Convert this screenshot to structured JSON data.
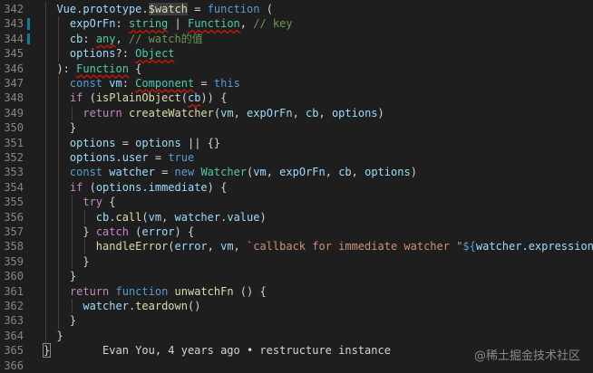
{
  "editor": {
    "lines": [
      {
        "num": "342",
        "changed": false,
        "tokens": [
          [
            "plain",
            "  "
          ],
          [
            "var",
            "Vue"
          ],
          [
            "punc",
            "."
          ],
          [
            "var",
            "prototype"
          ],
          [
            "punc",
            "."
          ],
          [
            "fn",
            "$watch"
          ],
          [
            "punc",
            " = "
          ],
          [
            "kw",
            "function"
          ],
          [
            "punc",
            " ("
          ]
        ]
      },
      {
        "num": "343",
        "changed": true,
        "tokens": [
          [
            "plain",
            "    "
          ],
          [
            "var",
            "expOrFn"
          ],
          [
            "punc",
            ": "
          ],
          [
            "type",
            "string"
          ],
          [
            "punc",
            " | "
          ],
          [
            "type",
            "Function"
          ],
          [
            "punc",
            ", "
          ],
          [
            "com",
            "// key"
          ]
        ]
      },
      {
        "num": "344",
        "changed": true,
        "tokens": [
          [
            "plain",
            "    "
          ],
          [
            "var",
            "cb"
          ],
          [
            "punc",
            ": "
          ],
          [
            "type",
            "any"
          ],
          [
            "punc",
            ", "
          ],
          [
            "com",
            "// watch的值"
          ]
        ]
      },
      {
        "num": "345",
        "changed": false,
        "tokens": [
          [
            "plain",
            "    "
          ],
          [
            "var",
            "options"
          ],
          [
            "punc",
            "?: "
          ],
          [
            "type",
            "Object"
          ]
        ]
      },
      {
        "num": "346",
        "changed": false,
        "tokens": [
          [
            "plain",
            "  "
          ],
          [
            "punc",
            "): "
          ],
          [
            "type",
            "Function"
          ],
          [
            "punc",
            " {"
          ]
        ]
      },
      {
        "num": "347",
        "changed": false,
        "tokens": [
          [
            "plain",
            "    "
          ],
          [
            "kw",
            "const"
          ],
          [
            "punc",
            " "
          ],
          [
            "var",
            "vm"
          ],
          [
            "punc",
            ": "
          ],
          [
            "type",
            "Component"
          ],
          [
            "punc",
            " = "
          ],
          [
            "kw",
            "this"
          ]
        ]
      },
      {
        "num": "348",
        "changed": false,
        "tokens": [
          [
            "plain",
            "    "
          ],
          [
            "ctl",
            "if"
          ],
          [
            "punc",
            " ("
          ],
          [
            "fn",
            "isPlainObject"
          ],
          [
            "punc",
            "("
          ],
          [
            "var",
            "cb"
          ],
          [
            "punc",
            ")) {"
          ]
        ]
      },
      {
        "num": "349",
        "changed": false,
        "tokens": [
          [
            "plain",
            "      "
          ],
          [
            "ctl",
            "return"
          ],
          [
            "punc",
            " "
          ],
          [
            "fn",
            "createWatcher"
          ],
          [
            "punc",
            "("
          ],
          [
            "var",
            "vm"
          ],
          [
            "punc",
            ", "
          ],
          [
            "var",
            "expOrFn"
          ],
          [
            "punc",
            ", "
          ],
          [
            "var",
            "cb"
          ],
          [
            "punc",
            ", "
          ],
          [
            "var",
            "options"
          ],
          [
            "punc",
            ")"
          ]
        ]
      },
      {
        "num": "350",
        "changed": false,
        "tokens": [
          [
            "plain",
            "    "
          ],
          [
            "punc",
            "}"
          ]
        ]
      },
      {
        "num": "351",
        "changed": false,
        "tokens": [
          [
            "plain",
            "    "
          ],
          [
            "var",
            "options"
          ],
          [
            "punc",
            " = "
          ],
          [
            "var",
            "options"
          ],
          [
            "punc",
            " || {}"
          ]
        ]
      },
      {
        "num": "352",
        "changed": false,
        "tokens": [
          [
            "plain",
            "    "
          ],
          [
            "var",
            "options"
          ],
          [
            "punc",
            "."
          ],
          [
            "var",
            "user"
          ],
          [
            "punc",
            " = "
          ],
          [
            "kw",
            "true"
          ]
        ]
      },
      {
        "num": "353",
        "changed": false,
        "tokens": [
          [
            "plain",
            "    "
          ],
          [
            "kw",
            "const"
          ],
          [
            "punc",
            " "
          ],
          [
            "var",
            "watcher"
          ],
          [
            "punc",
            " = "
          ],
          [
            "kw",
            "new"
          ],
          [
            "punc",
            " "
          ],
          [
            "type",
            "Watcher"
          ],
          [
            "punc",
            "("
          ],
          [
            "var",
            "vm"
          ],
          [
            "punc",
            ", "
          ],
          [
            "var",
            "expOrFn"
          ],
          [
            "punc",
            ", "
          ],
          [
            "var",
            "cb"
          ],
          [
            "punc",
            ", "
          ],
          [
            "var",
            "options"
          ],
          [
            "punc",
            ")"
          ]
        ]
      },
      {
        "num": "354",
        "changed": false,
        "tokens": [
          [
            "plain",
            "    "
          ],
          [
            "ctl",
            "if"
          ],
          [
            "punc",
            " ("
          ],
          [
            "var",
            "options"
          ],
          [
            "punc",
            "."
          ],
          [
            "var",
            "immediate"
          ],
          [
            "punc",
            ") {"
          ]
        ]
      },
      {
        "num": "355",
        "changed": false,
        "tokens": [
          [
            "plain",
            "      "
          ],
          [
            "ctl",
            "try"
          ],
          [
            "punc",
            " {"
          ]
        ]
      },
      {
        "num": "356",
        "changed": false,
        "tokens": [
          [
            "plain",
            "        "
          ],
          [
            "var",
            "cb"
          ],
          [
            "punc",
            "."
          ],
          [
            "fn",
            "call"
          ],
          [
            "punc",
            "("
          ],
          [
            "var",
            "vm"
          ],
          [
            "punc",
            ", "
          ],
          [
            "var",
            "watcher"
          ],
          [
            "punc",
            "."
          ],
          [
            "var",
            "value"
          ],
          [
            "punc",
            ")"
          ]
        ]
      },
      {
        "num": "357",
        "changed": false,
        "tokens": [
          [
            "plain",
            "      "
          ],
          [
            "punc",
            "} "
          ],
          [
            "ctl",
            "catch"
          ],
          [
            "punc",
            " ("
          ],
          [
            "var",
            "error"
          ],
          [
            "punc",
            ") {"
          ]
        ]
      },
      {
        "num": "358",
        "changed": false,
        "tokens": [
          [
            "plain",
            "        "
          ],
          [
            "fn",
            "handleError"
          ],
          [
            "punc",
            "("
          ],
          [
            "var",
            "error"
          ],
          [
            "punc",
            ", "
          ],
          [
            "var",
            "vm"
          ],
          [
            "punc",
            ", "
          ],
          [
            "str",
            "`callback for immediate watcher \""
          ],
          [
            "tpl",
            "${"
          ],
          [
            "var",
            "watcher"
          ],
          [
            "punc",
            "."
          ],
          [
            "var",
            "expression"
          ],
          [
            "tpl",
            "}"
          ],
          [
            "str",
            "\"`"
          ],
          [
            "punc",
            ")"
          ]
        ]
      },
      {
        "num": "359",
        "changed": false,
        "tokens": [
          [
            "plain",
            "      "
          ],
          [
            "punc",
            "}"
          ]
        ]
      },
      {
        "num": "360",
        "changed": false,
        "tokens": [
          [
            "plain",
            "    "
          ],
          [
            "punc",
            "}"
          ]
        ]
      },
      {
        "num": "361",
        "changed": false,
        "tokens": [
          [
            "plain",
            "    "
          ],
          [
            "ctl",
            "return"
          ],
          [
            "punc",
            " "
          ],
          [
            "kw",
            "function"
          ],
          [
            "punc",
            " "
          ],
          [
            "fn",
            "unwatchFn"
          ],
          [
            "punc",
            " () {"
          ]
        ]
      },
      {
        "num": "362",
        "changed": false,
        "tokens": [
          [
            "plain",
            "      "
          ],
          [
            "var",
            "watcher"
          ],
          [
            "punc",
            "."
          ],
          [
            "fn",
            "teardown"
          ],
          [
            "punc",
            "()"
          ]
        ]
      },
      {
        "num": "363",
        "changed": false,
        "tokens": [
          [
            "plain",
            "    "
          ],
          [
            "punc",
            "}"
          ]
        ]
      },
      {
        "num": "364",
        "changed": false,
        "tokens": [
          [
            "plain",
            "  "
          ],
          [
            "punc",
            "}"
          ]
        ]
      },
      {
        "num": "365",
        "changed": false,
        "tokens": [
          [
            "punc",
            "}"
          ],
          [
            "blame",
            "        Evan You, 4 years ago • restructure instance"
          ]
        ]
      },
      {
        "num": "366",
        "changed": false,
        "tokens": []
      }
    ]
  },
  "watermark": "@稀土掘金技术社区",
  "colors": {
    "background": "#1e1e1e",
    "keyword": "#569cd6",
    "control": "#c586c0",
    "function": "#dcdcaa",
    "variable": "#9cdcfe",
    "type": "#4ec9b0",
    "string": "#ce9178",
    "comment": "#6a9955"
  }
}
